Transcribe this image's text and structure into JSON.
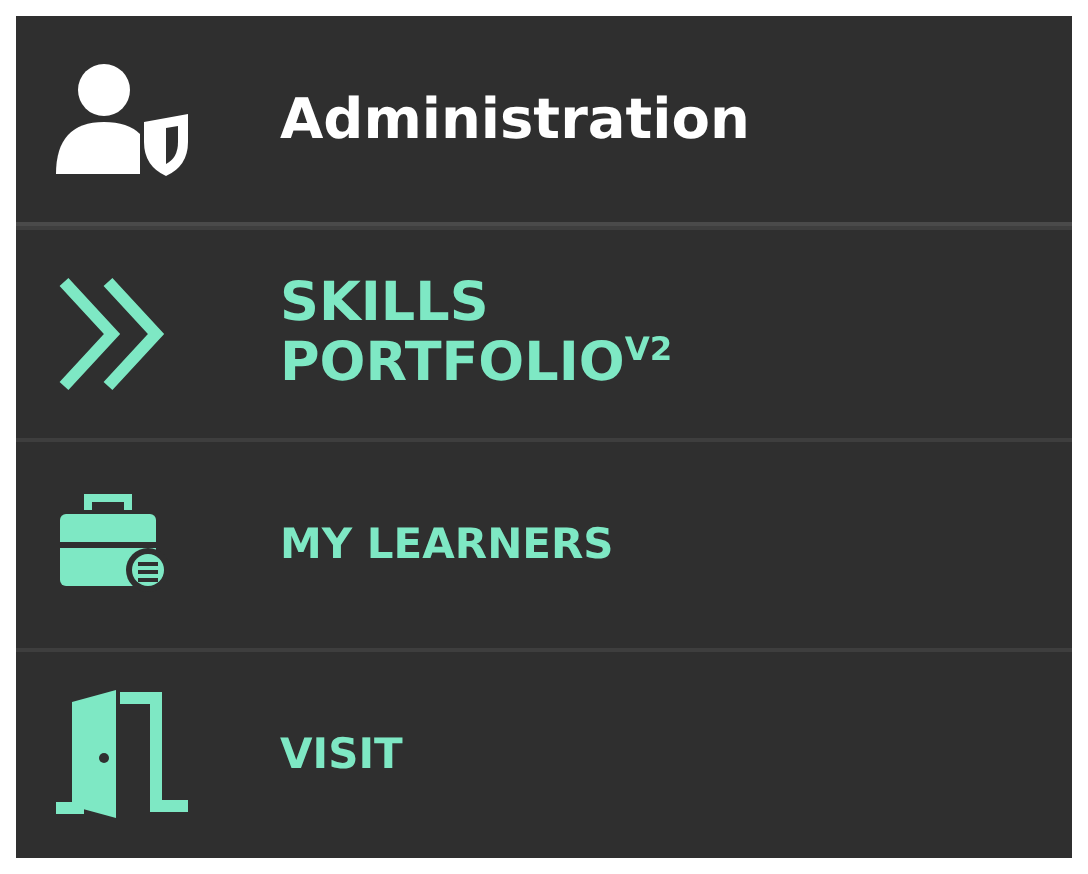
{
  "menu": {
    "items": [
      {
        "kind": "admin",
        "label": "Administration"
      },
      {
        "kind": "skills",
        "label": "SKILLS\nPORTFOLIO$^{V2}$"
      },
      {
        "kind": "learners",
        "label": "MY LEARNERS"
      },
      {
        "kind": "visit",
        "label": "VISIT"
      }
    ]
  }
}
